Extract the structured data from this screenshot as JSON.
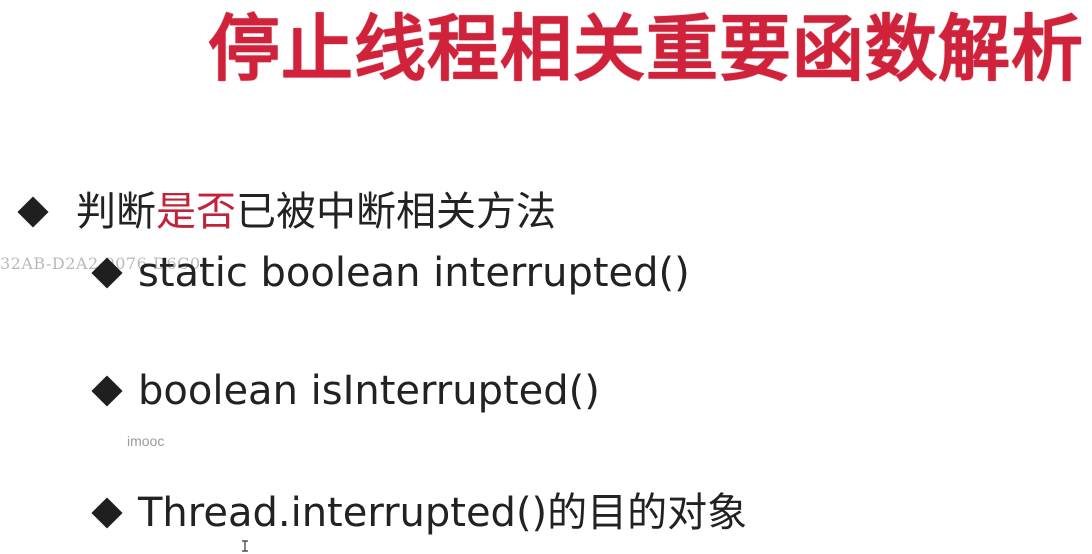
{
  "slide": {
    "title": "停止线程相关重要函数解析",
    "heading_prefix": "判断",
    "heading_accent": "是否",
    "heading_suffix": "已被中断相关方法",
    "items": [
      {
        "label": "static boolean interrupted()"
      },
      {
        "label": "boolean isInterrupted()"
      },
      {
        "label": "Thread.interrupted()的目的对象"
      }
    ],
    "watermark": "32AB-D2A2-0076-D6C0",
    "brand": "imooc"
  },
  "colors": {
    "title": "#d0223a",
    "accent": "#c0233a",
    "text": "#222222",
    "bullet": "#1f1f1f"
  },
  "icons": {
    "bullet": "diamond-bullet-icon",
    "cursor": "text-cursor-icon"
  }
}
